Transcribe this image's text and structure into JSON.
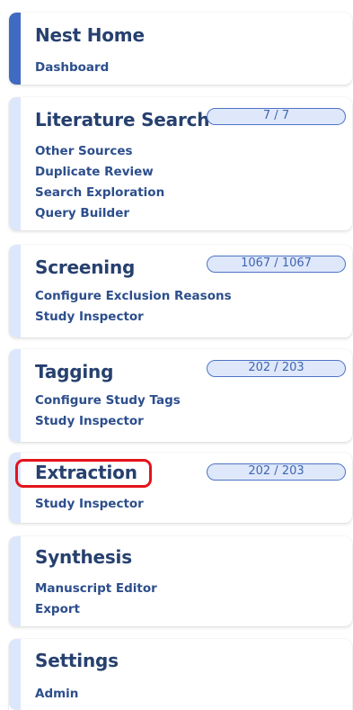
{
  "sections": [
    {
      "title": "Nest Home",
      "links": [
        "Dashboard"
      ]
    },
    {
      "title": "Literature Search",
      "badge": "7 / 7",
      "links": [
        "Other Sources",
        "Duplicate Review",
        "Search Exploration",
        "Query Builder"
      ]
    },
    {
      "title": "Screening",
      "badge": "1067 / 1067",
      "links": [
        "Configure Exclusion Reasons",
        "Study Inspector"
      ]
    },
    {
      "title": "Tagging",
      "badge": "202 / 203",
      "links": [
        "Configure Study Tags",
        "Study Inspector"
      ]
    },
    {
      "title": "Extraction",
      "badge": "202 / 203",
      "links": [
        "Study Inspector"
      ]
    },
    {
      "title": "Synthesis",
      "links": [
        "Manuscript Editor",
        "Export"
      ]
    },
    {
      "title": "Settings",
      "links": [
        "Admin"
      ]
    }
  ],
  "colors": {
    "active_bar": "#3f6bc2",
    "inactive_bar": "#dde7fb",
    "title": "#26406f",
    "link": "#2c4e8c",
    "badge_border": "#4c74c6",
    "badge_fill": "#dfe8fb",
    "highlight": "#e3141b"
  }
}
